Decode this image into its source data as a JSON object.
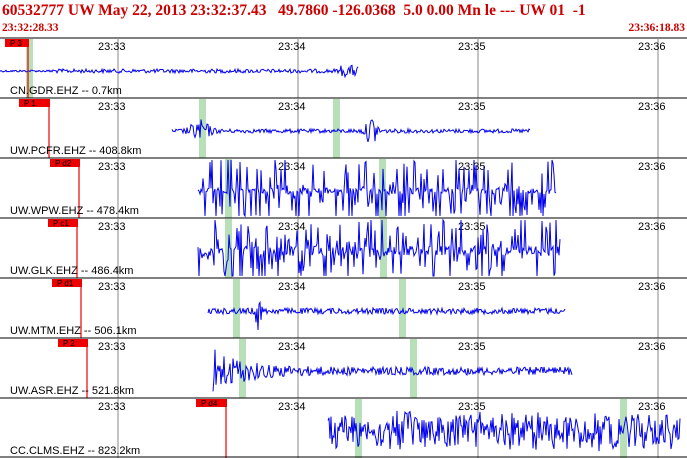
{
  "header": {
    "title": "60532777 UW May 22, 2013 23:32:37.43   49.7860 -126.0368  5.0 0.00 Mn le --- UW 01  -1",
    "start_time": "23:32:28.33",
    "end_time": "23:36:18.83"
  },
  "time_ticks": [
    "23:33",
    "23:34",
    "23:35",
    "23:36"
  ],
  "colors": {
    "header_text": "#cc0000",
    "waveform": "#0000ee",
    "pick_marker": "#ee0000",
    "phase_band": "#b8e0b8",
    "tick_line": "#8a8a8a",
    "separator": "#000000"
  },
  "traces": [
    {
      "label": "CN.GDR.EHZ -- 0.7km",
      "pick": "P 3",
      "style": "spike-early"
    },
    {
      "label": "UW.PCFR.EHZ -- 408.8km",
      "pick": "P 1",
      "style": "bursty"
    },
    {
      "label": "UW.WPW.EHZ -- 478.4km",
      "pick": "P d2",
      "style": "clipped"
    },
    {
      "label": "UW.GLK.EHZ -- 486.4km",
      "pick": "P c1",
      "style": "clipped-heavy"
    },
    {
      "label": "UW.MTM.EHZ -- 506.1km",
      "pick": "P d1",
      "style": "noise-spike"
    },
    {
      "label": "UW.ASR.EHZ -- 521.8km",
      "pick": "P 2",
      "style": "decay"
    },
    {
      "label": "CC.CLMS.EHZ -- 823.2km",
      "pick": "P d4",
      "style": "dense"
    }
  ]
}
